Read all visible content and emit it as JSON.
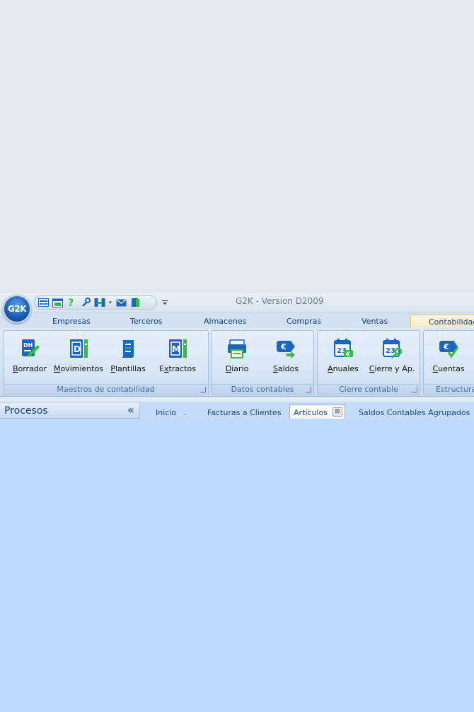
{
  "window": {
    "title": "G2K -  Version D2009",
    "app_logo": "G2K",
    "quick_access": [
      "calculator-icon",
      "calendar-icon",
      "help-icon",
      "wrench-icon",
      "network-icon",
      "mail-icon",
      "exit-door-icon"
    ]
  },
  "ribbon_tabs": [
    {
      "label": "Empresas"
    },
    {
      "label": "Terceros"
    },
    {
      "label": "Almacenes"
    },
    {
      "label": "Compras"
    },
    {
      "label": "Ventas"
    },
    {
      "label": "Contabilidad",
      "active": true
    }
  ],
  "ribbon_groups": [
    {
      "label": "Maestros de contabilidad",
      "buttons": [
        {
          "accel": "B",
          "rest": "orrador",
          "icon": "dh-document-pen-icon"
        },
        {
          "accel": "M",
          "rest": "ovimientos",
          "icon": "d-book-icon"
        },
        {
          "accel": "P",
          "rest": "lantillas",
          "icon": "scroll-icon"
        },
        {
          "accel": "",
          "pre": "E",
          "accel2": "x",
          "rest": "tractos",
          "icon": "m-book-icon"
        }
      ]
    },
    {
      "label": "Datos contables",
      "buttons": [
        {
          "accel": "D",
          "rest": "iario",
          "icon": "printer-diary-icon"
        },
        {
          "accel": "S",
          "rest": "aldos",
          "icon": "euro-tag-arrow-icon"
        }
      ]
    },
    {
      "label": "Cierre contable",
      "buttons": [
        {
          "accel": "A",
          "rest": "nuales",
          "icon": "calendar-euro-icon"
        },
        {
          "accel": "C",
          "rest": "ierre y Ap.",
          "icon": "calendar-key-icon"
        }
      ]
    },
    {
      "label": "Estructura",
      "buttons": [
        {
          "accel": "C",
          "rest": "uentas",
          "icon": "euro-tag-check-icon"
        }
      ]
    }
  ],
  "procesos_panel": {
    "title": "Procesos",
    "collapse_glyph": "«"
  },
  "document_tabs": [
    {
      "label": "Inicio"
    },
    {
      "label": "."
    },
    {
      "label": "Facturas a Clientes"
    },
    {
      "label": "Artículos",
      "active": true,
      "close_glyph": "⊠"
    },
    {
      "label": "Saldos Contables Agrupados"
    }
  ],
  "colors": {
    "accent": "#15428b",
    "icon_blue": "#1c65c0",
    "icon_green": "#2fbf3a",
    "workspace": "#bfdafe"
  }
}
